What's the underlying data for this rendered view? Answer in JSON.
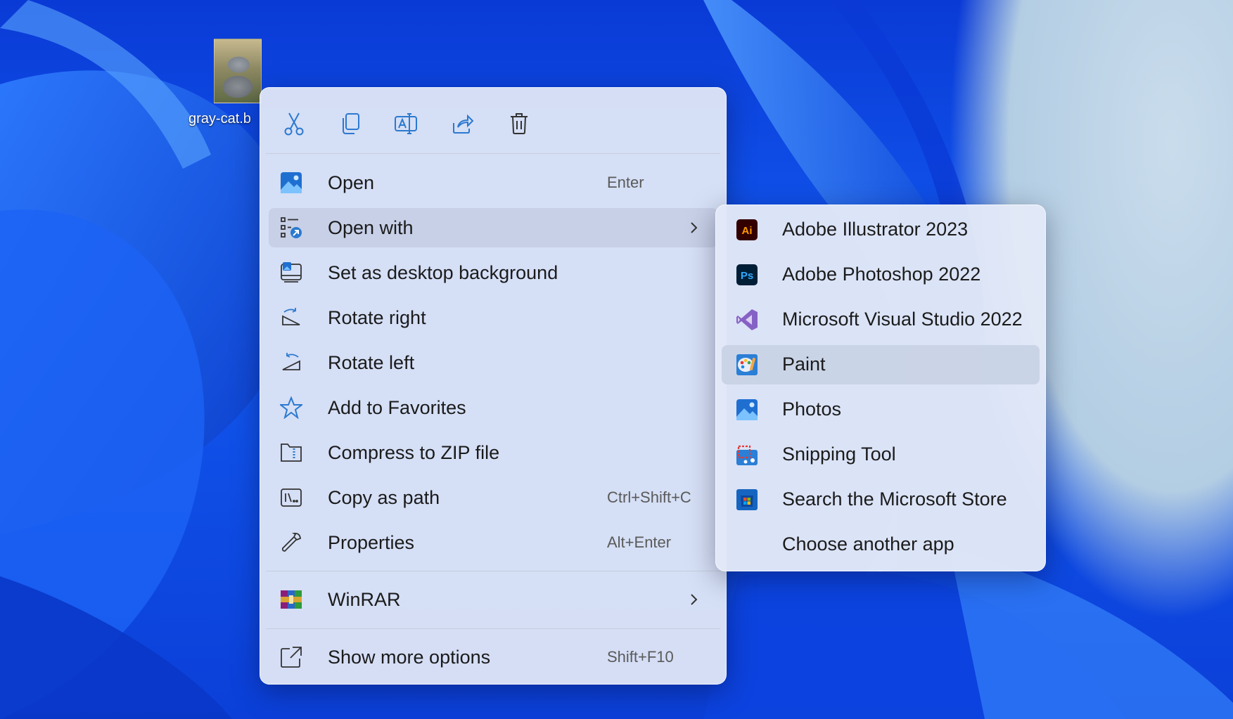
{
  "desktop": {
    "file_label": "gray-cat.b"
  },
  "toolbar": {
    "items": [
      {
        "name": "cut-icon",
        "tooltip": "Cut"
      },
      {
        "name": "copy-icon",
        "tooltip": "Copy"
      },
      {
        "name": "rename-icon",
        "tooltip": "Rename"
      },
      {
        "name": "share-icon",
        "tooltip": "Share"
      },
      {
        "name": "delete-icon",
        "tooltip": "Delete"
      }
    ]
  },
  "menu": {
    "items": [
      {
        "label": "Open",
        "shortcut": "Enter",
        "icon": "photos-icon"
      },
      {
        "label": "Open with",
        "shortcut": "",
        "icon": "open-with-icon",
        "has_submenu": true
      },
      {
        "label": "Set as desktop background",
        "shortcut": "",
        "icon": "desktop-background-icon"
      },
      {
        "label": "Rotate right",
        "shortcut": "",
        "icon": "rotate-right-icon"
      },
      {
        "label": "Rotate left",
        "shortcut": "",
        "icon": "rotate-left-icon"
      },
      {
        "label": "Add to Favorites",
        "shortcut": "",
        "icon": "star-icon"
      },
      {
        "label": "Compress to ZIP file",
        "shortcut": "",
        "icon": "zip-folder-icon"
      },
      {
        "label": "Copy as path",
        "shortcut": "Ctrl+Shift+C",
        "icon": "copy-path-icon"
      },
      {
        "label": "Properties",
        "shortcut": "Alt+Enter",
        "icon": "wrench-icon"
      },
      {
        "label": "WinRAR",
        "shortcut": "",
        "icon": "winrar-icon",
        "has_submenu": true
      },
      {
        "label": "Show more options",
        "shortcut": "Shift+F10",
        "icon": "show-more-icon"
      }
    ]
  },
  "submenu": {
    "items": [
      {
        "label": "Adobe Illustrator 2023",
        "icon": "illustrator-icon",
        "badge": "Ai"
      },
      {
        "label": "Adobe Photoshop 2022",
        "icon": "photoshop-icon",
        "badge": "Ps"
      },
      {
        "label": "Microsoft Visual Studio 2022",
        "icon": "visual-studio-icon"
      },
      {
        "label": "Paint",
        "icon": "paint-icon"
      },
      {
        "label": "Photos",
        "icon": "photos-icon"
      },
      {
        "label": "Snipping Tool",
        "icon": "snipping-tool-icon"
      },
      {
        "label": "Search the Microsoft Store",
        "icon": "microsoft-store-icon"
      },
      {
        "label": "Choose another app",
        "icon": ""
      }
    ]
  },
  "colors": {
    "accent": "#0f6cbd",
    "wallpaper": "#1259f0"
  }
}
